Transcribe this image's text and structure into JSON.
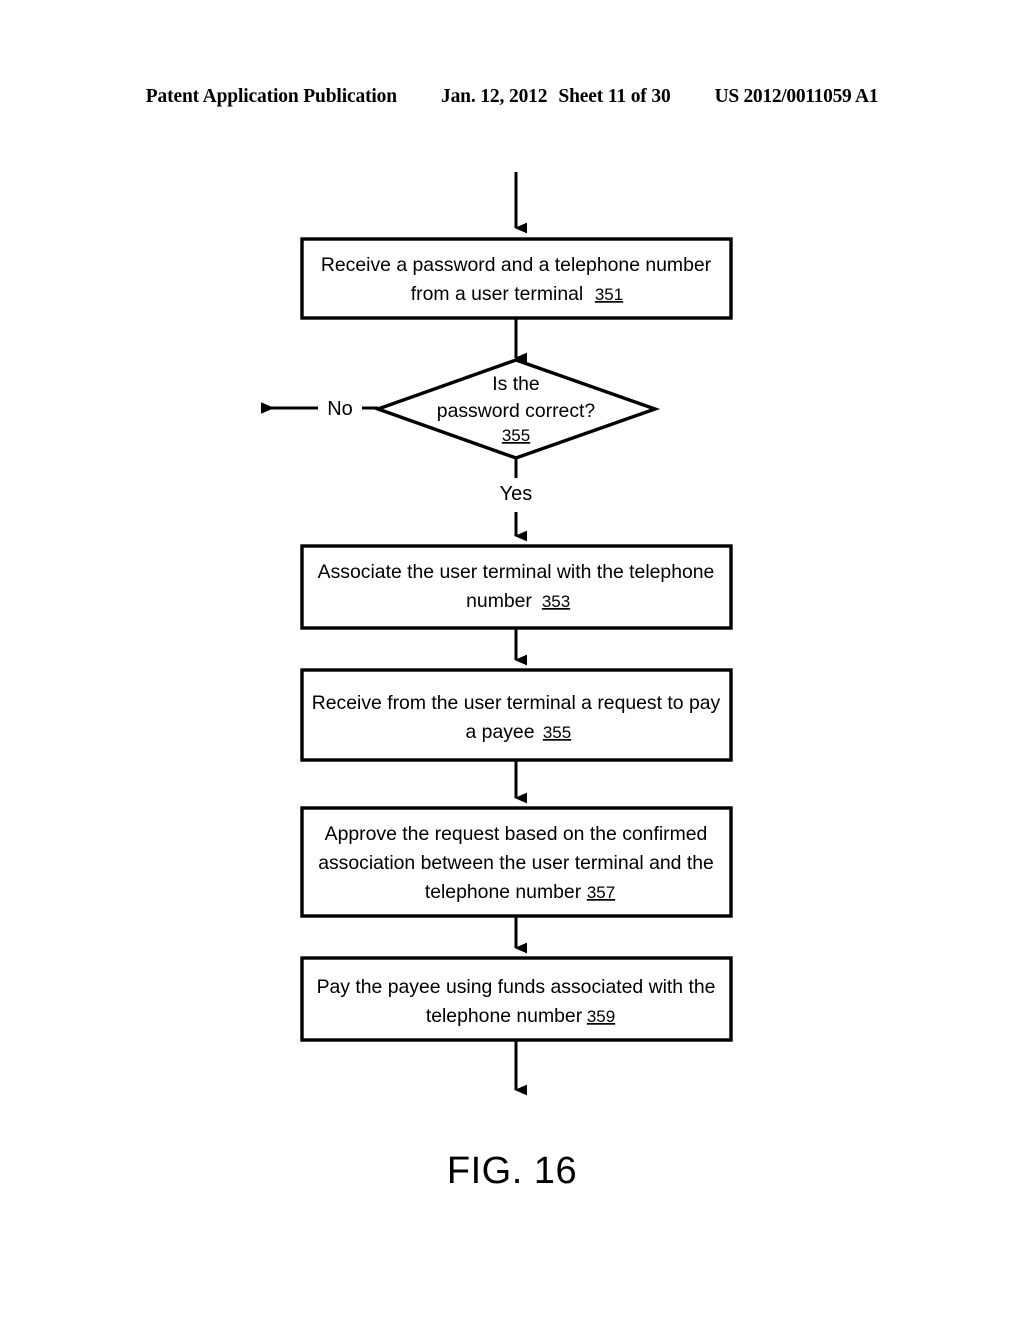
{
  "header": {
    "publication": "Patent Application Publication",
    "date": "Jan. 12, 2012",
    "sheet": "Sheet 11 of 30",
    "patent_number": "US 2012/0011059 A1"
  },
  "figure": {
    "label": "FIG. 16"
  },
  "colors": {
    "ink": "#000000",
    "paper": "#ffffff"
  },
  "flowchart": {
    "type": "flowchart",
    "nodes": [
      {
        "id": "n351",
        "shape": "process",
        "lines": [
          "Receive a password and a telephone number",
          "from a user terminal"
        ],
        "line1": "Receive a password and a telephone number",
        "line2": "from a user terminal",
        "line3": "",
        "ref": "351"
      },
      {
        "id": "n355d",
        "shape": "decision",
        "lines": [
          "Is the",
          "password correct?"
        ],
        "line1": "Is the",
        "line2": "password correct?",
        "line3": "",
        "ref": "355"
      },
      {
        "id": "n353",
        "shape": "process",
        "lines": [
          "Associate the user terminal with the telephone",
          "number"
        ],
        "line1": "Associate the user terminal with the telephone",
        "line2": "number",
        "line3": "",
        "ref": "353"
      },
      {
        "id": "n355b",
        "shape": "process",
        "lines": [
          "Receive from the user terminal a request to pay",
          "a payee"
        ],
        "line1": "Receive from the user terminal a request to pay",
        "line2": "a payee",
        "line3": "",
        "ref": "355"
      },
      {
        "id": "n357",
        "shape": "process",
        "lines": [
          "Approve the request based on the confirmed",
          "association between the user terminal and the",
          "telephone number"
        ],
        "line1": "Approve the request based on the confirmed",
        "line2": "association between the user terminal and the",
        "line3": "telephone number",
        "ref": "357"
      },
      {
        "id": "n359",
        "shape": "process",
        "lines": [
          "Pay the payee using funds associated with the",
          "telephone number"
        ],
        "line1": "Pay the payee using funds associated with the",
        "line2": "telephone number",
        "ref": "359"
      }
    ],
    "branches": {
      "no_label": "No",
      "yes_label": "Yes"
    }
  }
}
